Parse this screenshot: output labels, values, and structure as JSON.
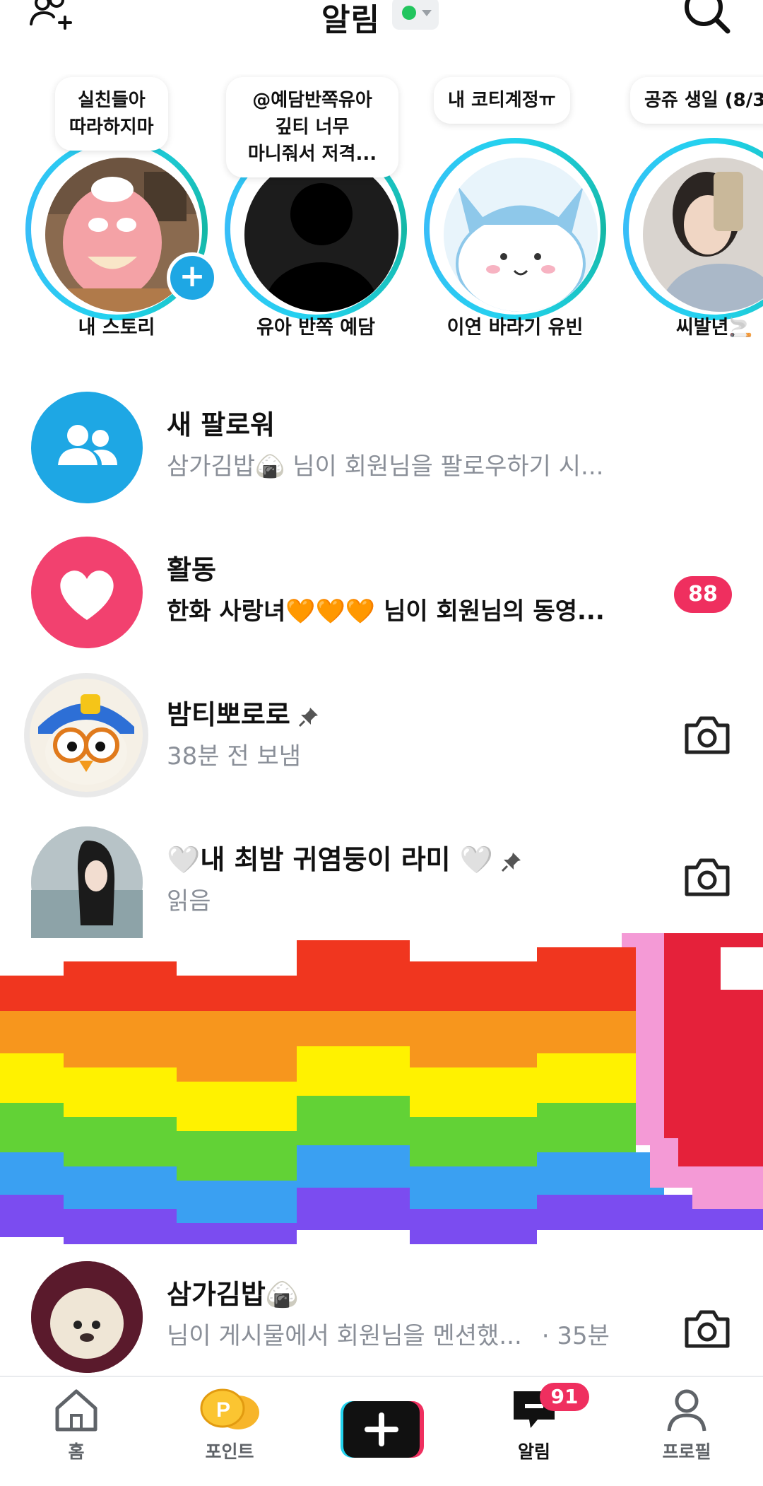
{
  "header": {
    "title": "알림",
    "status_color": "#22c55e"
  },
  "stories": [
    {
      "name": "내 스토리",
      "bubble": "실친들아\n따라하지마",
      "has_add": true
    },
    {
      "name": "유아 반쪽 예담",
      "bubble": "@예담반쪽유아\n깊티 너무\n마니줘서 저격...",
      "has_add": false
    },
    {
      "name": "이연 바라기 유빈",
      "bubble": "내 코티계정ㅠ",
      "has_add": false
    },
    {
      "name": "씨발년🚬",
      "bubble": "공쥬 생일 (8/3",
      "has_add": false
    }
  ],
  "rows": {
    "follower": {
      "title": "새 팔로워",
      "sub": "삼가김밥🍙 님이 회원님을 팔로우하기 시..."
    },
    "activity": {
      "title": "활동",
      "sub": "한화 사랑녀🧡🧡🧡 님이 회원님의 동영...",
      "badge": "88"
    },
    "chat1": {
      "title": "밤티뽀로로",
      "sub": "38분 전 보냄",
      "pinned": true
    },
    "chat2": {
      "title": "🤍내 최밤 귀염둥이 라미 🤍",
      "sub": "읽음",
      "pinned": true
    },
    "mention": {
      "title": "삼가김밥🍙",
      "sub": "님이 게시물에서 회원님을 멘션했...",
      "time": "· 35분"
    }
  },
  "nav": {
    "home": "홈",
    "points": "포인트",
    "notifications": "알림",
    "notifications_badge": "91",
    "profile": "프로필"
  },
  "colors": {
    "accent_pink": "#ef2f5f",
    "follower_blue": "#1ea7e4",
    "activity_pink": "#f2416f"
  }
}
